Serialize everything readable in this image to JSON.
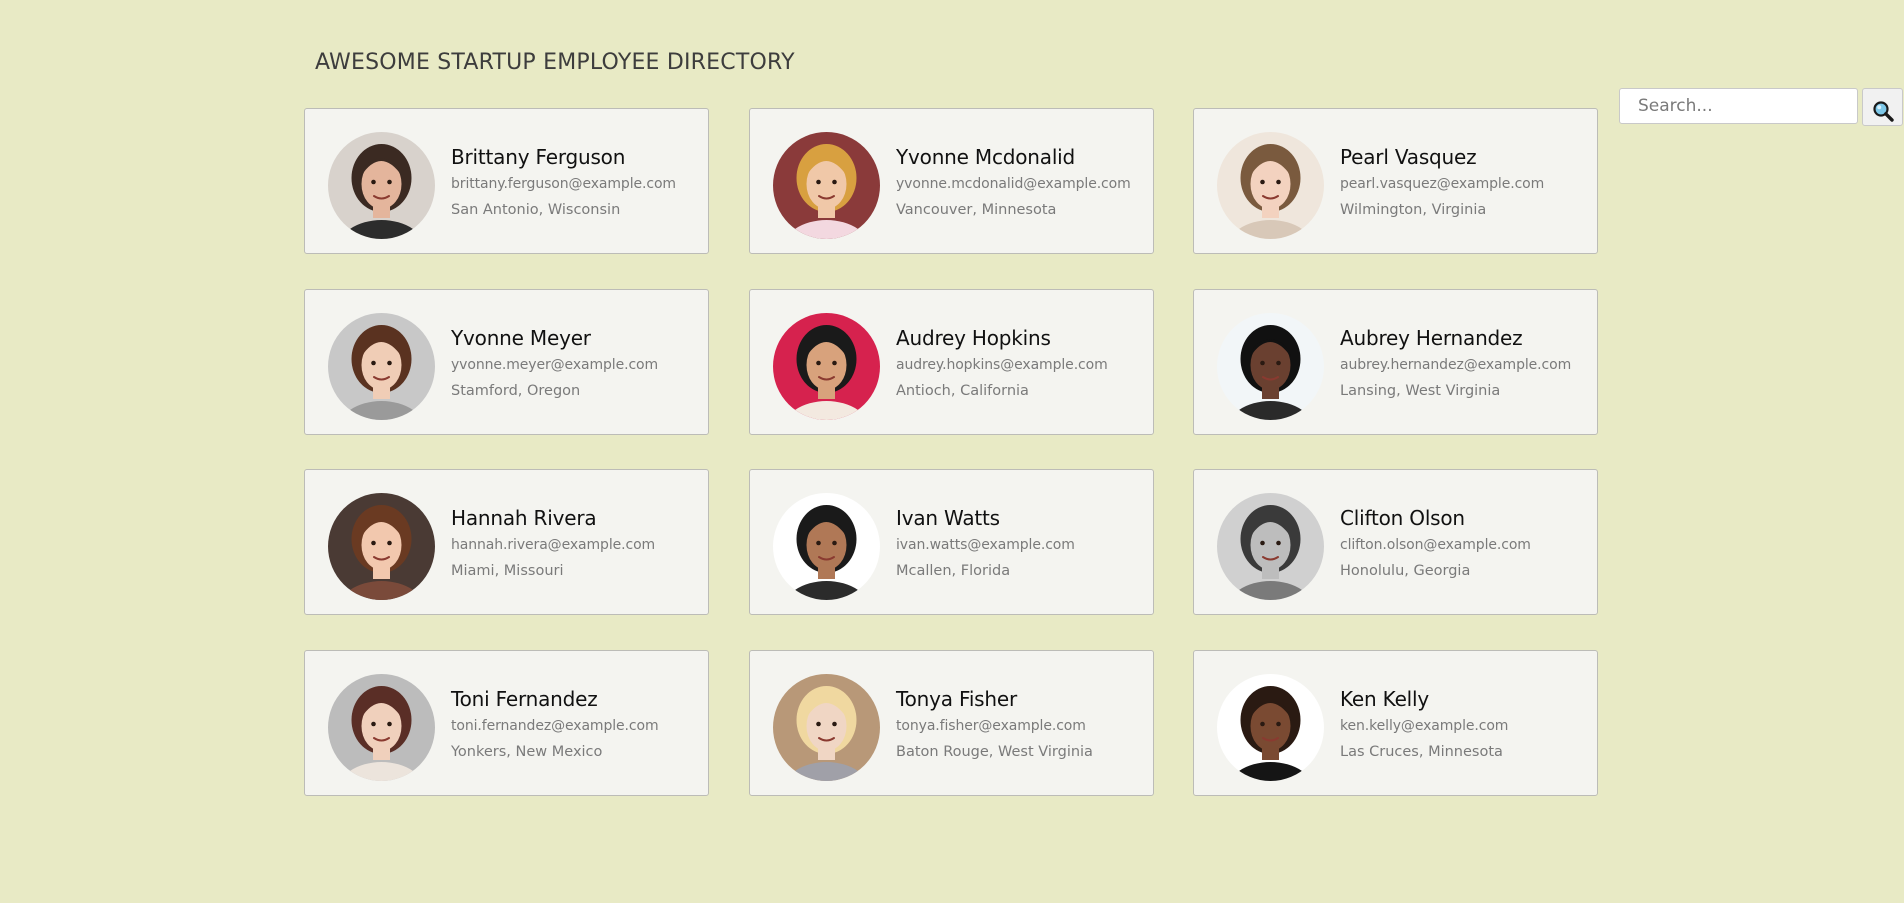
{
  "header": {
    "title": "AWESOME STARTUP EMPLOYEE DIRECTORY"
  },
  "search": {
    "placeholder": "Search...",
    "value": "",
    "button_icon": "search-icon"
  },
  "employees": [
    {
      "name": "Brittany Ferguson",
      "email": "brittany.ferguson@example.com",
      "location": "San Antonio, Wisconsin"
    },
    {
      "name": "Yvonne Mcdonalid",
      "email": "yvonne.mcdonalid@example.com",
      "location": "Vancouver, Minnesota"
    },
    {
      "name": "Pearl Vasquez",
      "email": "pearl.vasquez@example.com",
      "location": "Wilmington, Virginia"
    },
    {
      "name": "Yvonne Meyer",
      "email": "yvonne.meyer@example.com",
      "location": "Stamford, Oregon"
    },
    {
      "name": "Audrey Hopkins",
      "email": "audrey.hopkins@example.com",
      "location": "Antioch, California"
    },
    {
      "name": "Aubrey Hernandez",
      "email": "aubrey.hernandez@example.com",
      "location": "Lansing, West Virginia"
    },
    {
      "name": "Hannah Rivera",
      "email": "hannah.rivera@example.com",
      "location": "Miami, Missouri"
    },
    {
      "name": "Ivan Watts",
      "email": "ivan.watts@example.com",
      "location": "Mcallen, Florida"
    },
    {
      "name": "Clifton Olson",
      "email": "clifton.olson@example.com",
      "location": "Honolulu, Georgia"
    },
    {
      "name": "Toni Fernandez",
      "email": "toni.fernandez@example.com",
      "location": "Yonkers, New Mexico"
    },
    {
      "name": "Tonya Fisher",
      "email": "tonya.fisher@example.com",
      "location": "Baton Rouge, West Virginia"
    },
    {
      "name": "Ken Kelly",
      "email": "ken.kelly@example.com",
      "location": "Las Cruces, Minnesota"
    }
  ],
  "colors": {
    "page_background": "#e8eac5",
    "card_background": "#f4f4f0",
    "card_border": "#bcbcb7",
    "name_text": "#111111",
    "detail_text": "#7a7a7a"
  }
}
